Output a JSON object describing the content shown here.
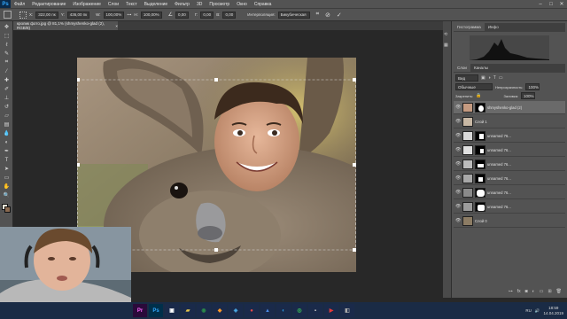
{
  "app": {
    "logo": "Ps",
    "menu": [
      "Файл",
      "Редактирование",
      "Изображение",
      "Слои",
      "Текст",
      "Выделение",
      "Фильтр",
      "3D",
      "Просмотр",
      "Окно",
      "Справка"
    ]
  },
  "options_bar": {
    "x_value": "322,00 пк",
    "y_value": "436,00 пк",
    "w_value": "100,00%",
    "h_value": "100,00%",
    "angle_value": "0,00",
    "h_skew": "0,00",
    "v_skew": "0,00",
    "interp_label": "Интерполяция:",
    "interp_value": "Бикубическая"
  },
  "document": {
    "tab_title": "кролик фото.jpg @ 81,1% (shmyshenko-glad (2), RGB/8)"
  },
  "panels": {
    "histogram_tab": "Гистограмма",
    "info_tab": "Инфо",
    "layers_tab": "Слои",
    "channels_tab": "Каналы",
    "kind_label": "Вид",
    "blend_mode": "Обычные",
    "opacity_label": "Непрозрачность:",
    "opacity_value": "100%",
    "lock_label": "Закрепить:",
    "fill_label": "Заливка:",
    "fill_value": "100%"
  },
  "layers": [
    {
      "name": "shmyshenko-glad (2)",
      "type": "photo-mask"
    },
    {
      "name": "Слой 1",
      "type": "plain"
    },
    {
      "name": "unnamed 76...",
      "type": "photo-mask"
    },
    {
      "name": "unnamed 76...",
      "type": "photo-mask"
    },
    {
      "name": "unnamed 76...",
      "type": "photo-mask"
    },
    {
      "name": "unnamed 76...",
      "type": "photo-mask"
    },
    {
      "name": "unnamed 76...",
      "type": "photo-mask"
    },
    {
      "name": "unnamed 76...",
      "type": "photo-mask"
    },
    {
      "name": "Слой 0",
      "type": "plain"
    }
  ],
  "taskbar": {
    "time": "18:59",
    "date": "14.04.2019",
    "lang": "RU"
  },
  "colors": {
    "ui_bg": "#535353",
    "canvas_bg": "#282828",
    "taskbar": "#1a2b45",
    "accent": "#31a8ff"
  }
}
